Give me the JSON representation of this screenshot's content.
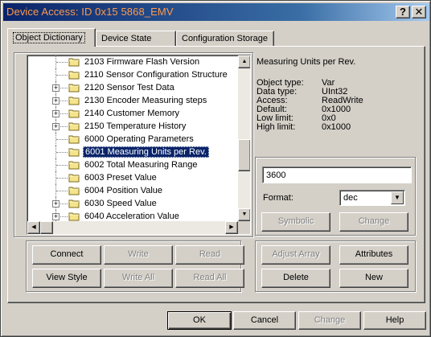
{
  "window": {
    "title": "Device Access: ID 0x15 5868_EMV",
    "help_button": "?",
    "close_button": "✕"
  },
  "tabs": [
    {
      "label": "Object Dictionary",
      "active": true
    },
    {
      "label": "Device State",
      "active": false
    },
    {
      "label": "Configuration Storage",
      "active": false
    }
  ],
  "tree": {
    "items": [
      {
        "label": "2103 Firmware Flash Version",
        "expandable": false
      },
      {
        "label": "2110 Sensor Configuration Structure",
        "expandable": false
      },
      {
        "label": "2120 Sensor Test Data",
        "expandable": true
      },
      {
        "label": "2130 Encoder Measuring steps",
        "expandable": true
      },
      {
        "label": "2140 Customer Memory",
        "expandable": true
      },
      {
        "label": "2150 Temperature History",
        "expandable": true
      },
      {
        "label": "6000 Operating Parameters",
        "expandable": false
      },
      {
        "label": "6001 Measuring Units per Rev.",
        "expandable": false,
        "selected": true
      },
      {
        "label": "6002 Total Measuring Range",
        "expandable": false
      },
      {
        "label": "6003 Preset Value",
        "expandable": false
      },
      {
        "label": "6004 Position Value",
        "expandable": false
      },
      {
        "label": "6030 Speed Value",
        "expandable": true
      },
      {
        "label": "6040 Acceleration Value",
        "expandable": true
      }
    ]
  },
  "details": {
    "title": "Measuring Units per Rev.",
    "fields": [
      {
        "key": "Object type:",
        "value": "Var"
      },
      {
        "key": "Data type:",
        "value": "UInt32"
      },
      {
        "key": "Access:",
        "value": "ReadWrite"
      },
      {
        "key": "Default:",
        "value": "0x1000"
      },
      {
        "key": "Low limit:",
        "value": "0x0"
      },
      {
        "key": "High limit:",
        "value": "0x1000"
      }
    ],
    "value_input": "3600",
    "format_label": "Format:",
    "format_value": "dec",
    "symbolic_label": "Symbolic",
    "change_label": "Change"
  },
  "left_buttons": {
    "connect": "Connect",
    "write": "Write",
    "read": "Read",
    "view_style": "View Style",
    "write_all": "Write All",
    "read_all": "Read All"
  },
  "right_buttons": {
    "adjust_array": "Adjust Array",
    "attributes": "Attributes",
    "delete": "Delete",
    "new": "New"
  },
  "footer": {
    "ok": "OK",
    "cancel": "Cancel",
    "change": "Change",
    "help": "Help"
  },
  "colors": {
    "title_gradient_start": "#0a246a",
    "title_text": "#ff9a4a",
    "selection": "#0a246a",
    "dialog_face": "#d4d0c8",
    "folder": "#f5e48a"
  }
}
